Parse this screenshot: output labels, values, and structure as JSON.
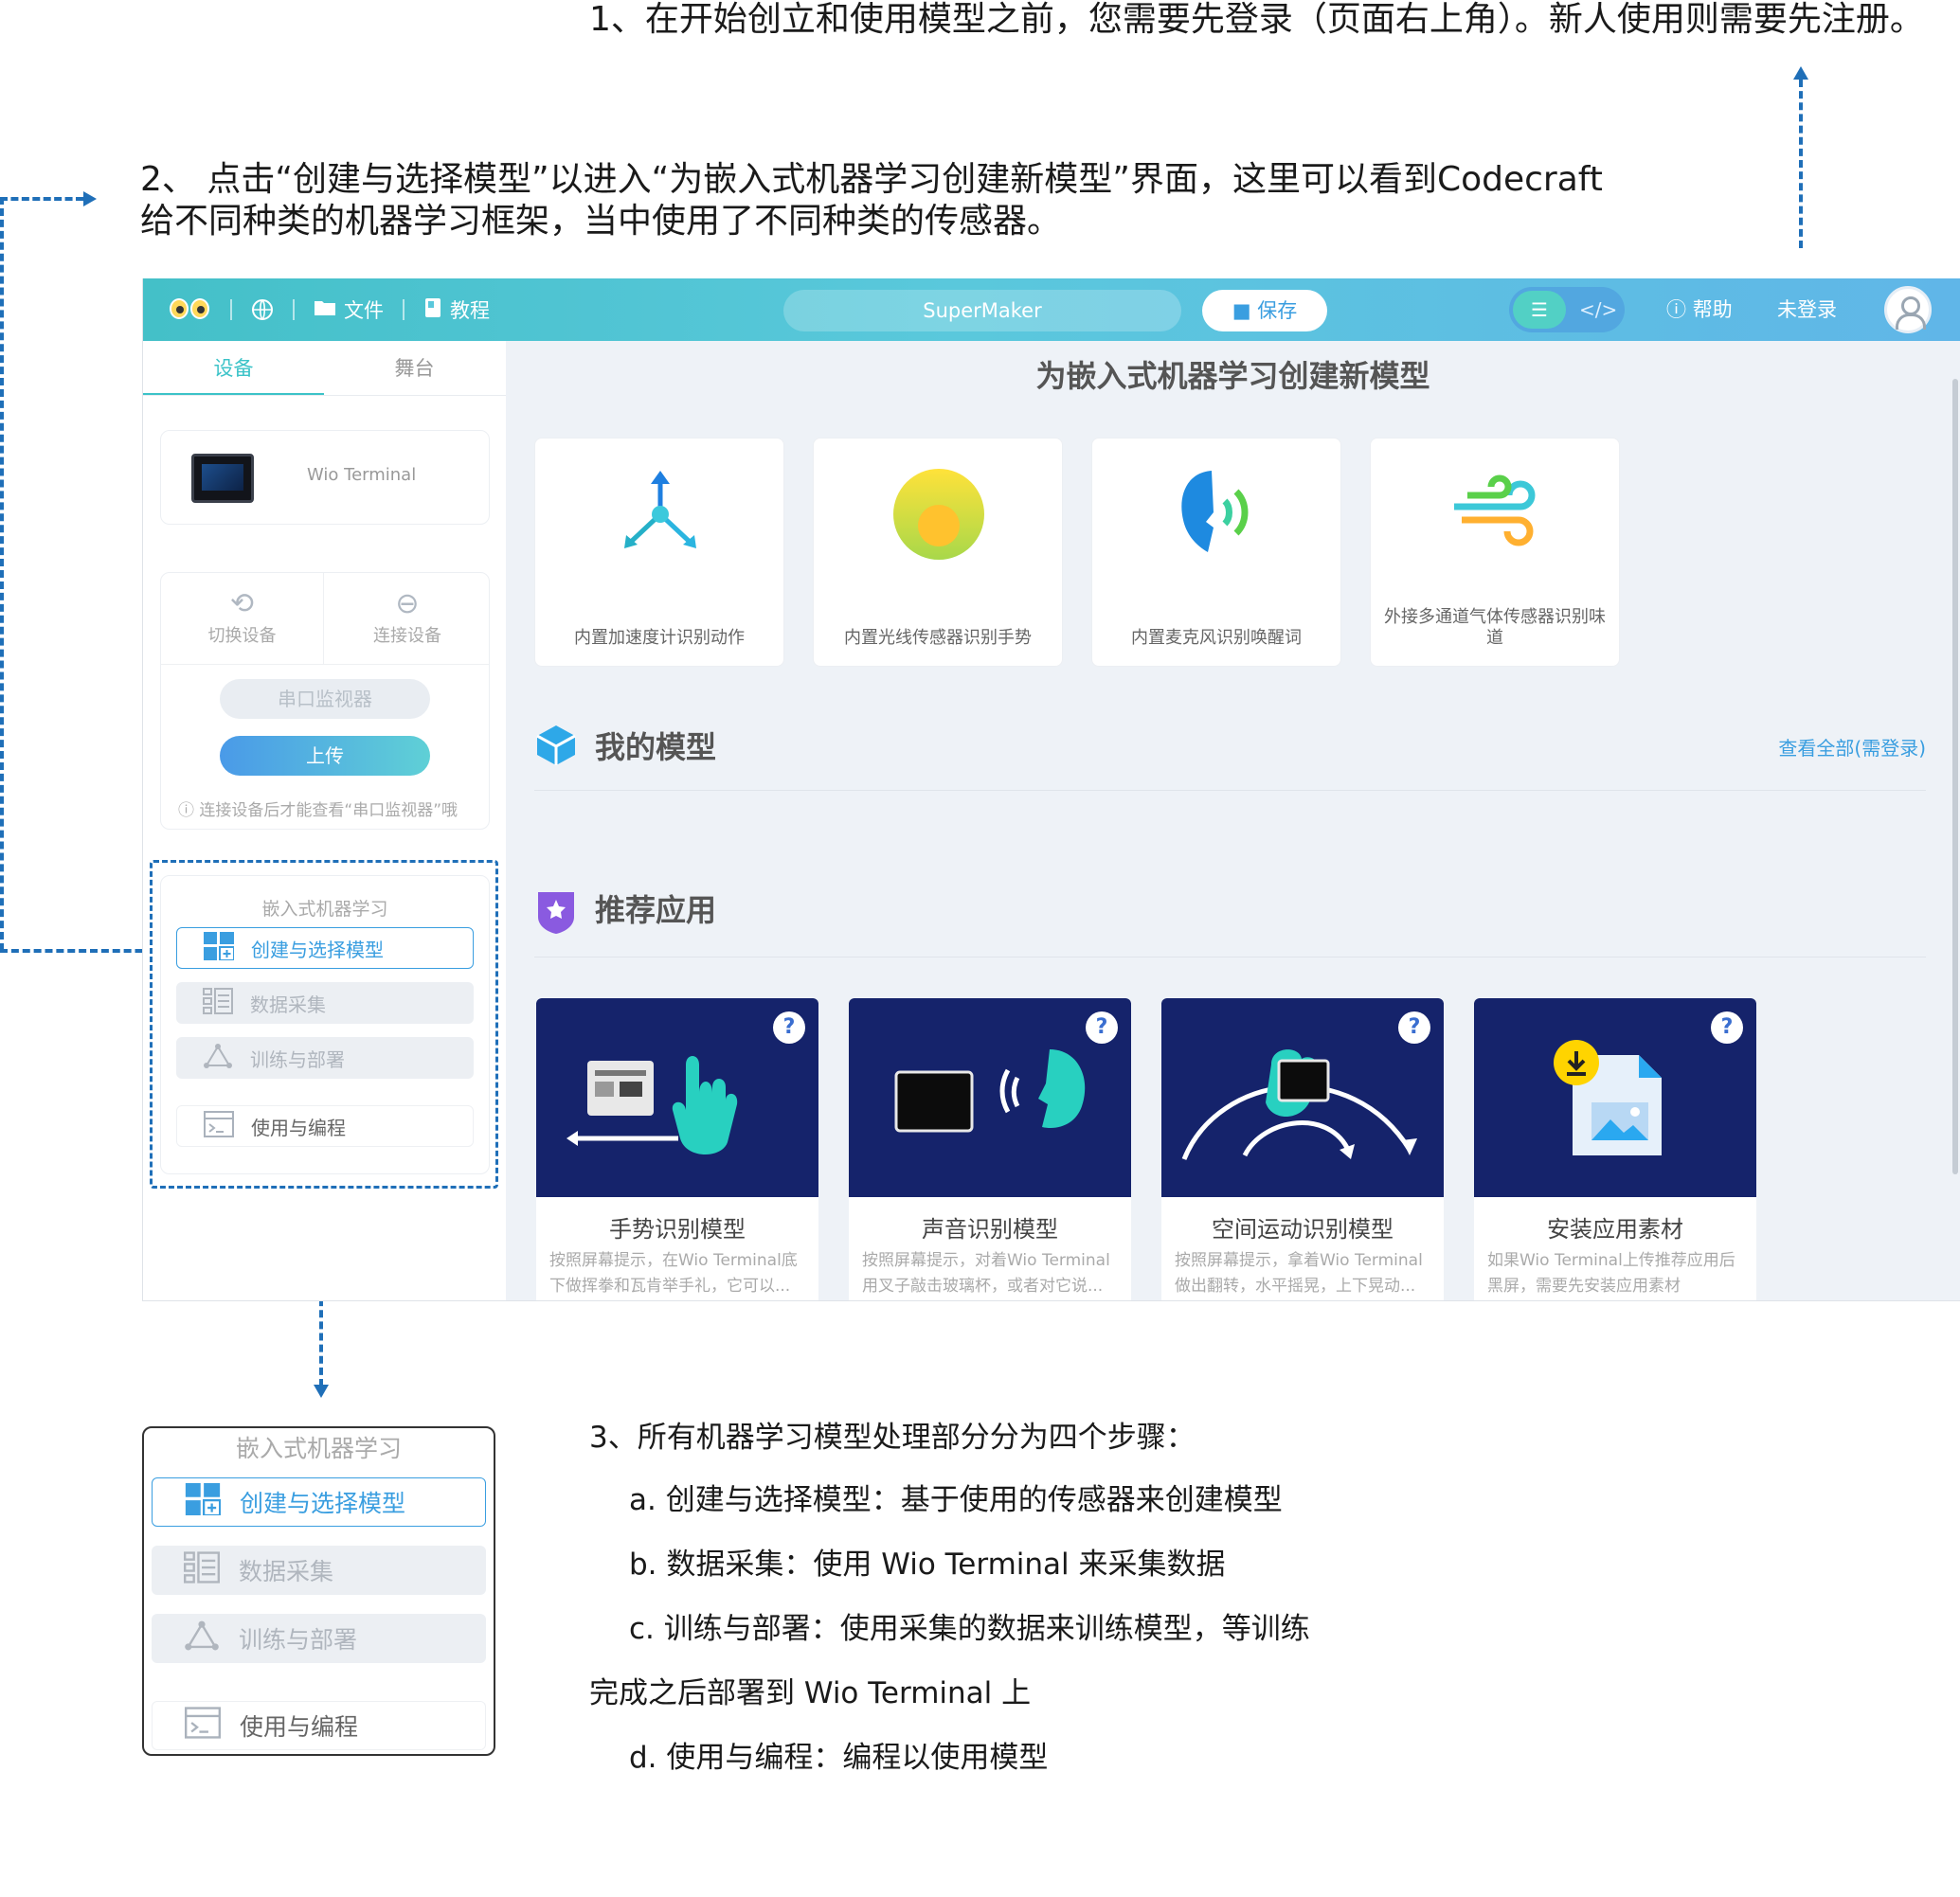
{
  "notes": {
    "n1": "1、在开始创立和使用模型之前，您需要先登录（页面右上角）。新人使用则需要先注册。",
    "n2_line1": "2、 点击“创建与选择模型”以进入“为嵌入式机器学习创建新模型”界面，这里可以看到Codecraft",
    "n2_line2": "给不同种类的机器学习框架，当中使用了不同种类的传感器。",
    "n3": "3、所有机器学习模型处理部分分为四个步骤：",
    "step_a": "a. 创建与选择模型：基于使用的传感器来创建模型",
    "step_b": "b. 数据采集：使用 Wio Terminal 来采集数据",
    "step_c_line1": "c. 训练与部署：使用采集的数据来训练模型，等训练",
    "step_c_line2": "完成之后部署到 Wio Terminal 上",
    "step_d": "d. 使用与编程：编程以使用模型"
  },
  "topbar": {
    "file": "文件",
    "tutorial": "教程",
    "search_value": "SuperMaker",
    "save": "保存",
    "help": "帮助",
    "login": "未登录",
    "code_icon": "</>"
  },
  "left": {
    "tab_device": "设备",
    "tab_stage": "舞台",
    "device_name": "Wio Terminal",
    "switch_device": "切换设备",
    "connect_device": "连接设备",
    "serial_monitor": "串口监视器",
    "upload": "上传",
    "tip": "连接设备后才能查看“串口监视器”哦",
    "ml_title": "嵌入式机器学习",
    "ml_items": [
      "创建与选择模型",
      "数据采集",
      "训练与部署",
      "使用与编程"
    ]
  },
  "main": {
    "title": "为嵌入式机器学习创建新模型",
    "sensors": [
      "内置加速度计识别动作",
      "内置光线传感器识别手势",
      "内置麦克风识别唤醒词",
      "外接多通道气体传感器识别味",
      "道"
    ],
    "my_models": "我的模型",
    "view_all": "查看全部(需登录)",
    "recommended": "推荐应用",
    "apps": [
      {
        "title": "手势识别模型",
        "d1": "按照屏幕提示，在Wio Terminal底",
        "d2": "下做挥拳和瓦肯举手礼，它可以..."
      },
      {
        "title": "声音识别模型",
        "d1": "按照屏幕提示，对着Wio Terminal",
        "d2": "用叉子敲击玻璃杯，或者对它说..."
      },
      {
        "title": "空间运动识别模型",
        "d1": "按照屏幕提示，拿着Wio Terminal",
        "d2": "做出翻转，水平摇晃，上下晃动..."
      },
      {
        "title": "安装应用素材",
        "d1": "如果Wio Terminal上传推荐应用后",
        "d2": "黑屏，需要先安装应用素材"
      }
    ],
    "q": "?"
  },
  "colors": {
    "accent": "#3a9ee0",
    "teal": "#3cc3c8",
    "guide": "#1f6fb8",
    "thumb": "#15236b"
  }
}
